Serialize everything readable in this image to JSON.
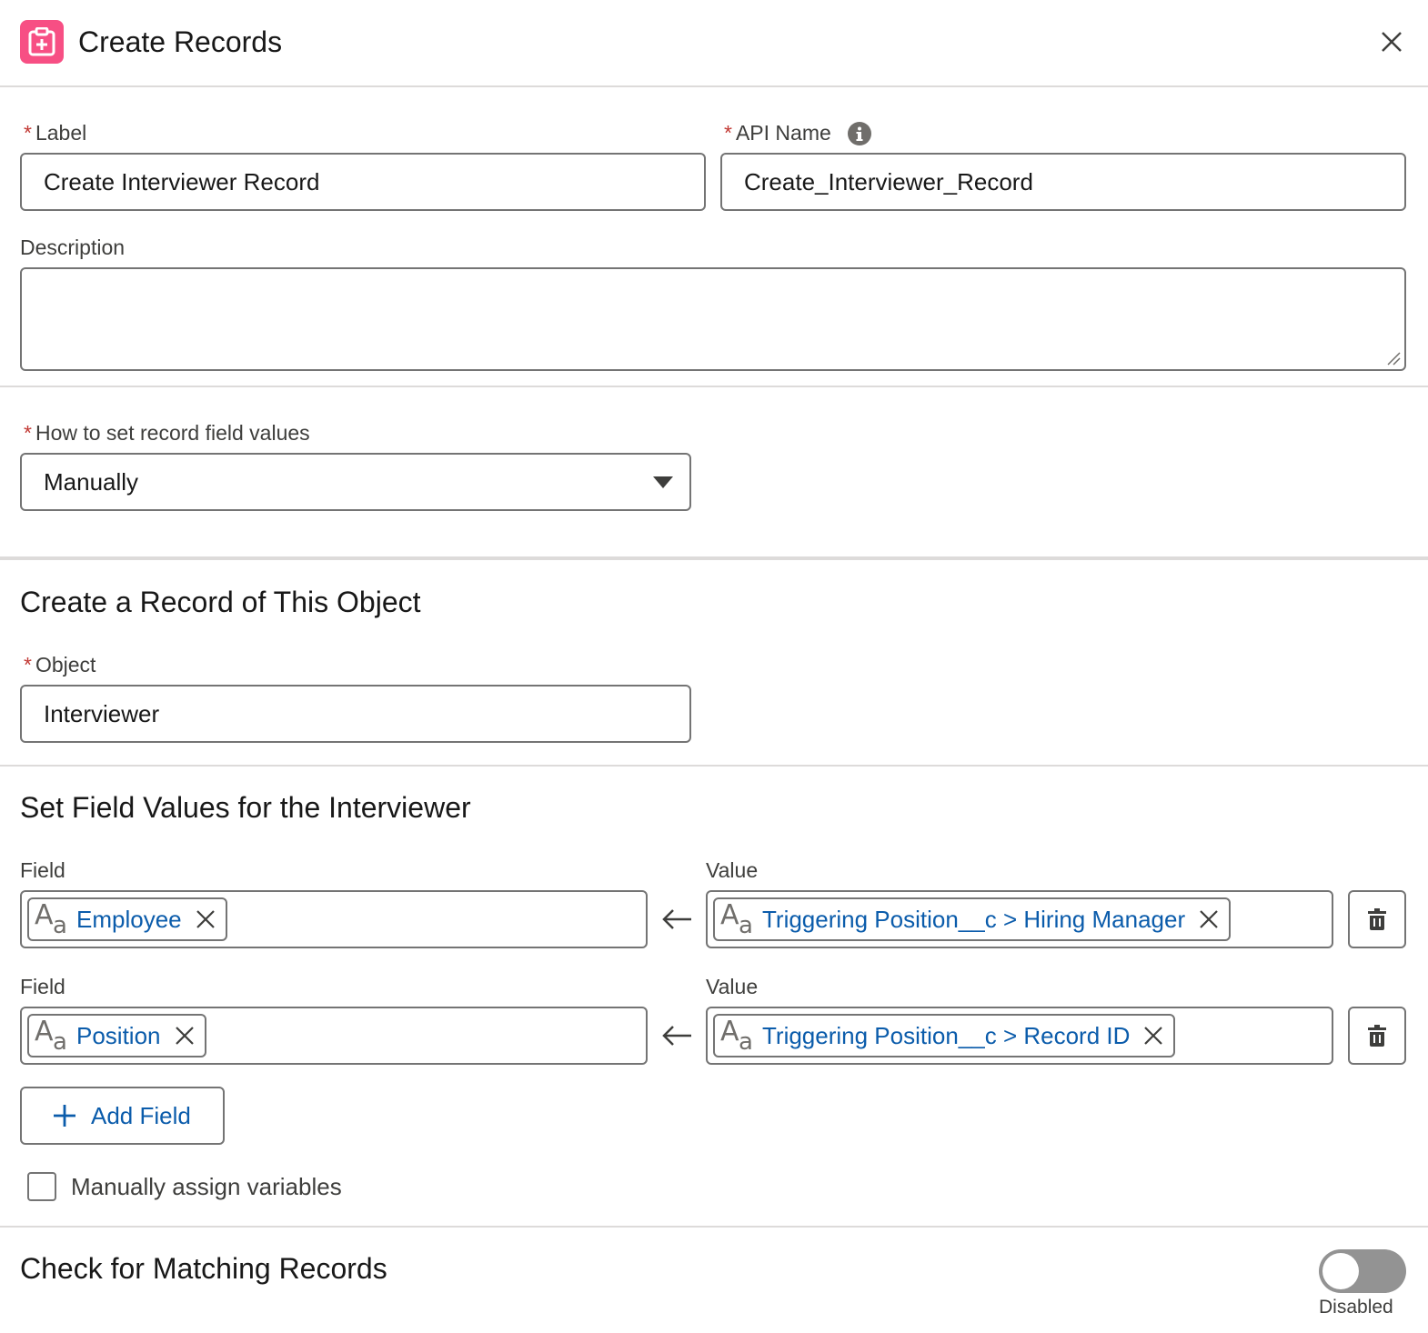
{
  "header": {
    "title": "Create Records",
    "icon": "create-record-icon",
    "icon_color": "#f74f84"
  },
  "general": {
    "label_label": "Label",
    "label_value": "Create Interviewer Record",
    "api_name_label": "API Name",
    "api_name_value": "Create_Interviewer_Record",
    "description_label": "Description",
    "description_value": ""
  },
  "how_to_set": {
    "label": "How to set record field values",
    "selected": "Manually"
  },
  "object_section": {
    "title": "Create a Record of This Object",
    "object_label": "Object",
    "object_value": "Interviewer"
  },
  "field_values_section": {
    "title": "Set Field Values for the Interviewer",
    "rows": [
      {
        "field_label": "Field",
        "field_value": "Employee",
        "value_label": "Value",
        "value_value": "Triggering Position__c > Hiring Manager"
      },
      {
        "field_label": "Field",
        "field_value": "Position",
        "value_label": "Value",
        "value_value": "Triggering Position__c > Record ID"
      }
    ],
    "add_field_label": "Add Field",
    "manually_assign_label": "Manually assign variables"
  },
  "matching_section": {
    "title": "Check for Matching Records",
    "toggle_state_label": "Disabled"
  },
  "colors": {
    "link_blue": "#0b5cab",
    "required_red": "#c23934",
    "border": "#747474"
  }
}
